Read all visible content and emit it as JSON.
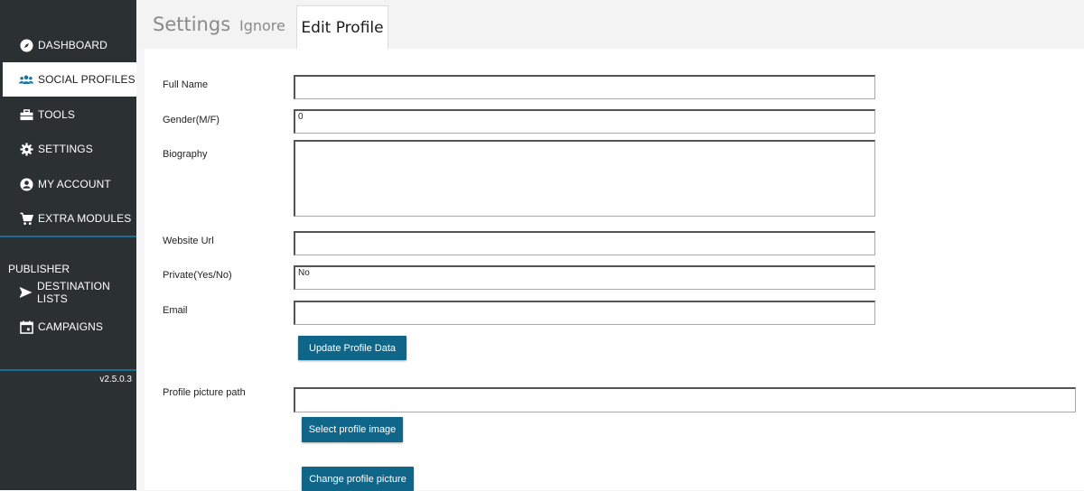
{
  "sidebar": {
    "items": [
      {
        "label": "DASHBOARD",
        "icon": "compass-icon"
      },
      {
        "label": "SOCIAL PROFILES",
        "icon": "users-icon",
        "active": true
      },
      {
        "label": "TOOLS",
        "icon": "toolbox-icon"
      },
      {
        "label": "SETTINGS",
        "icon": "gear-icon"
      },
      {
        "label": "MY ACCOUNT",
        "icon": "user-circle-icon"
      },
      {
        "label": "EXTRA MODULES",
        "icon": "cart-icon"
      }
    ],
    "publisher": {
      "label": "PUBLISHER",
      "items": [
        {
          "label": "DESTINATION LISTS",
          "icon": "send-icon"
        },
        {
          "label": "CAMPAIGNS",
          "icon": "calendar-icon"
        }
      ]
    },
    "version": "v2.5.0.3"
  },
  "tabs": {
    "settings": "Settings",
    "ignore": "Ignore",
    "edit_profile": "Edit Profile"
  },
  "form": {
    "full_name": {
      "label": "Full Name",
      "value": ""
    },
    "gender": {
      "label": "Gender(M/F)",
      "value": "0"
    },
    "biography": {
      "label": "Biography",
      "value": ""
    },
    "website": {
      "label": "Website Url",
      "value": ""
    },
    "private": {
      "label": "Private(Yes/No)",
      "value": "No"
    },
    "email": {
      "label": "Email",
      "value": ""
    },
    "update_button": "Update Profile Data",
    "picture_path": {
      "label": "Profile picture path",
      "value": ""
    },
    "select_image_button": "Select profile image",
    "change_picture_button": "Change profile picture"
  },
  "colors": {
    "sidebar_bg": "#2b3033",
    "accent_button": "#0f6688",
    "divider": "#1b75a0"
  }
}
